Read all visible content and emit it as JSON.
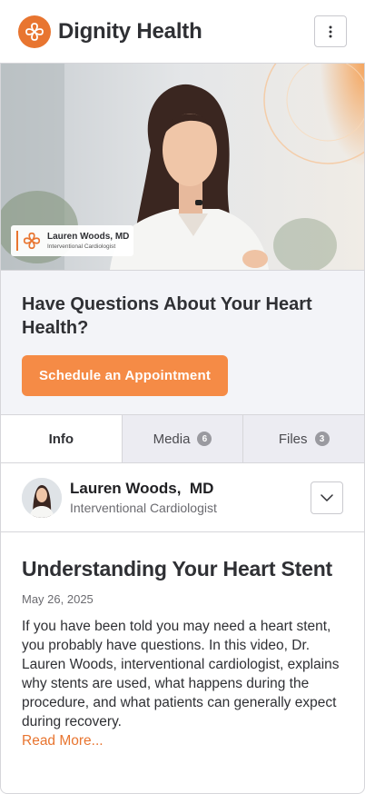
{
  "header": {
    "brand": "Dignity Health",
    "logo_icon": "dignity-health-logo",
    "menu_icon": "kebab-menu-icon",
    "accent_color": "#e87530"
  },
  "hero": {
    "tag_name": "Lauren Woods, MD",
    "tag_role": "Interventional Cardiologist"
  },
  "cta": {
    "title": "Have Questions About Your Heart Health?",
    "button_label": "Schedule an Appointment",
    "button_color": "#f58b46"
  },
  "tabs": [
    {
      "label": "Info",
      "active": true
    },
    {
      "label": "Media",
      "count": "6"
    },
    {
      "label": "Files",
      "count": "3"
    }
  ],
  "doctor": {
    "name": "Lauren Woods,  MD",
    "role": "Interventional Cardiologist",
    "expand_icon": "chevron-down-icon"
  },
  "article": {
    "title": "Understanding Your Heart Stent",
    "date": "May 26, 2025",
    "body": "If you have been told you may need a heart stent, you probably have questions. In this video, Dr. Lauren Woods, interventional cardiologist, explains why stents are used, what happens during the procedure, and what patients can generally expect during recovery.",
    "read_more": "Read More..."
  }
}
